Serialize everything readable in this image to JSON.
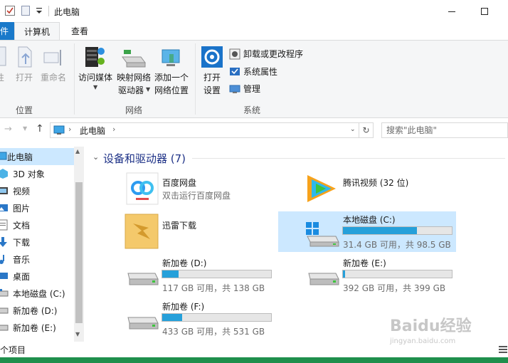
{
  "title_bar": {
    "title": "此电脑",
    "minimize_icon": "minimize-icon",
    "maximize_icon": "maximize-icon"
  },
  "ribbon": {
    "tabs": [
      {
        "label": "件"
      },
      {
        "label": "计算机"
      },
      {
        "label": "查看"
      }
    ],
    "groups": [
      {
        "label": "位置",
        "items": [
          {
            "label": "性"
          },
          {
            "label": "打开"
          },
          {
            "label": "重命名"
          }
        ]
      },
      {
        "label": "网络",
        "items": [
          {
            "label": "访问媒体"
          },
          {
            "label": "映射网络",
            "label2": "驱动器"
          },
          {
            "label": "添加一个",
            "label2": "网络位置"
          }
        ]
      },
      {
        "label": "系统",
        "items": [
          {
            "label": "打开",
            "label2": "设置"
          },
          {
            "label": "卸载或更改程序"
          },
          {
            "label": "系统属性"
          },
          {
            "label": "管理"
          }
        ]
      }
    ]
  },
  "address": {
    "path": "此电脑",
    "search_placeholder": "搜索\"此电脑\""
  },
  "nav": {
    "items": [
      {
        "label": "此电脑"
      },
      {
        "label": "3D 对象"
      },
      {
        "label": "视频"
      },
      {
        "label": "图片"
      },
      {
        "label": "文档"
      },
      {
        "label": "下载"
      },
      {
        "label": "音乐"
      },
      {
        "label": "桌面"
      },
      {
        "label": "本地磁盘 (C:)"
      },
      {
        "label": "新加卷 (D:)"
      },
      {
        "label": "新加卷 (E:)"
      }
    ]
  },
  "content": {
    "section_title": "设备和驱动器 (7)",
    "apps": [
      {
        "name": "百度网盘",
        "sub": "双击运行百度网盘"
      },
      {
        "name": "腾讯视频 (32 位)"
      },
      {
        "name": "迅雷下载"
      }
    ],
    "drives": [
      {
        "name": "本地磁盘 (C:)",
        "sub": "31.4 GB 可用，共 98.5 GB",
        "used_fraction": 0.68
      },
      {
        "name": "新加卷 (D:)",
        "sub": "117 GB 可用，共 138 GB",
        "used_fraction": 0.15
      },
      {
        "name": "新加卷 (E:)",
        "sub": "392 GB 可用，共 399 GB",
        "used_fraction": 0.02
      },
      {
        "name": "新加卷 (F:)",
        "sub": "433 GB 可用，共 531 GB",
        "used_fraction": 0.18
      }
    ]
  },
  "status": {
    "text": "个项目"
  },
  "watermark": {
    "brand": "Baidu经验",
    "url": "jingyan.baidu.com"
  },
  "colors": {
    "accent": "#1979ca",
    "drive_bar": "#26a0da",
    "selection": "#cce8ff",
    "section_title": "#1e3287"
  }
}
